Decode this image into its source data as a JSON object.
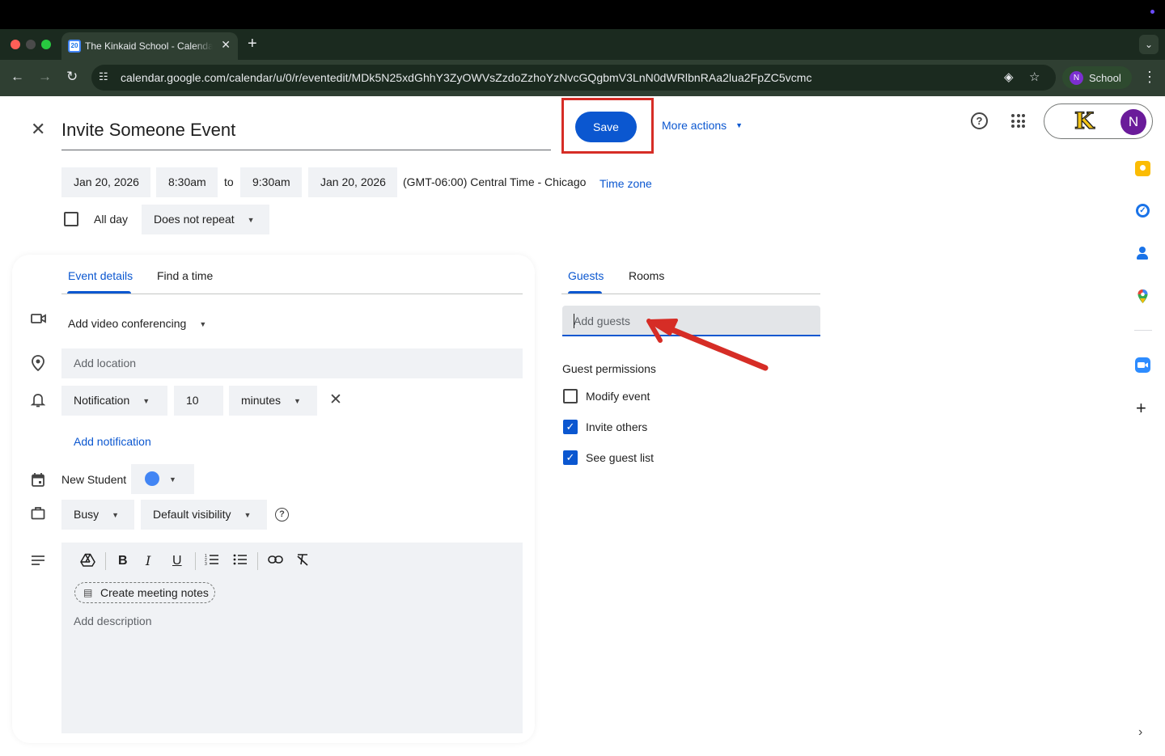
{
  "browser": {
    "tab_title": "The Kinkaid School - Calendar",
    "tab_close": "✕",
    "new_tab": "+",
    "favicon_text": "20",
    "url": "calendar.google.com/calendar/u/0/r/eventedit/MDk5N25xdGhhY3ZyOWVsZzdoZzhoYzNvcGQgbmV3LnN0dWRlbnRAa2lua2FpZC5vcmc",
    "profile_initial": "N",
    "profile_name": "School"
  },
  "header": {
    "event_title": "Invite Someone Event",
    "save_label": "Save",
    "more_actions_label": "More actions",
    "account_logo_text": "K",
    "account_initial": "N"
  },
  "datetime": {
    "start_date": "Jan 20, 2026",
    "start_time": "8:30am",
    "to_label": "to",
    "end_time": "9:30am",
    "end_date": "Jan 20, 2026",
    "timezone_text": "(GMT-06:00) Central Time - Chicago",
    "timezone_link": "Time zone",
    "all_day_label": "All day",
    "all_day_checked": false,
    "repeat_value": "Does not repeat"
  },
  "details": {
    "tabs": [
      "Event details",
      "Find a time"
    ],
    "active_tab": 0,
    "video_conferencing": "Add video conferencing",
    "location_placeholder": "Add location",
    "notification_type": "Notification",
    "notification_amount": "10",
    "notification_unit": "minutes",
    "add_notification": "Add notification",
    "calendar_name": "New Student",
    "calendar_color": "#4285f4",
    "availability": "Busy",
    "visibility": "Default visibility",
    "create_notes": "Create meeting notes",
    "description_placeholder": "Add description"
  },
  "guests": {
    "tabs": [
      "Guests",
      "Rooms"
    ],
    "active_tab": 0,
    "input_placeholder": "Add guests",
    "permissions_title": "Guest permissions",
    "permissions": [
      {
        "label": "Modify event",
        "checked": false
      },
      {
        "label": "Invite others",
        "checked": true
      },
      {
        "label": "See guest list",
        "checked": true
      }
    ]
  },
  "annotations": {
    "highlight_color": "#d62d26",
    "arrow_color": "#d62d26"
  },
  "colors": {
    "primary": "#0b57d0",
    "chrome_bg": "#2f3f32",
    "field_bg": "#f0f2f5"
  }
}
